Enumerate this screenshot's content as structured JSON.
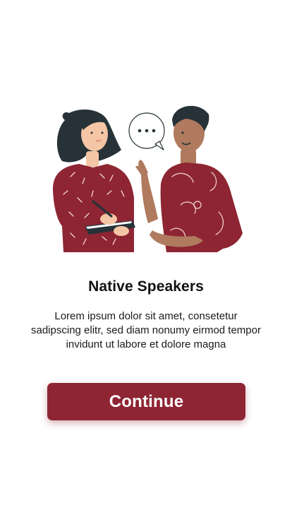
{
  "onboarding": {
    "title": "Native Speakers",
    "description": "Lorem ipsum dolor sit amet, consetetur sadipscing elitr, sed diam nonumy eirmod tempor invidunt ut labore et dolore magna",
    "continue_label": "Continue"
  },
  "illustration": {
    "subject": "two-people-conversation-illustration",
    "speech_bubble_icon": "ellipsis-speech-bubble-icon"
  },
  "colors": {
    "accent": "#8e2533",
    "shirt": "#8e2533",
    "hair": "#263238",
    "skin_light": "#f5c6a5",
    "skin_dark": "#b07a5e",
    "background": "#ffffff"
  }
}
